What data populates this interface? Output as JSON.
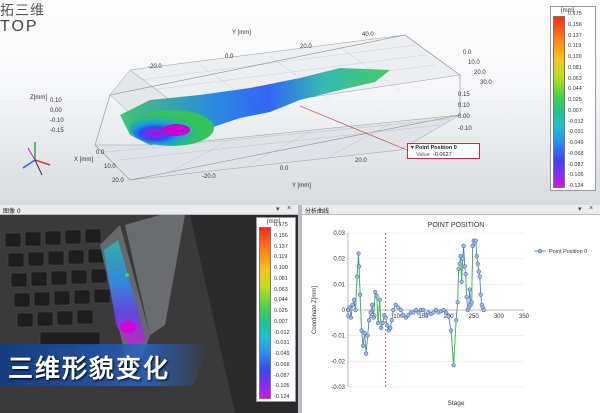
{
  "logo": {
    "cn": "拓三维",
    "en": "TOP"
  },
  "view3d": {
    "axis_y_label": "Y [mm]",
    "axis_y_ticks_top": [
      "-20.0",
      "0.0",
      "20.0",
      "40.0"
    ],
    "axis_x_ticks_right": [
      "0.0",
      "10.0",
      "20.0",
      "30.0"
    ],
    "axis_z_label": "Z[mm]",
    "axis_z_ticks": [
      "0.10",
      "0.00",
      "-0.10",
      "-0.15"
    ],
    "axis_z_ticks_right": [
      "0.15",
      "0.10",
      "0.00",
      "-0.10"
    ],
    "axis_x_label_left": "X [mm]",
    "axis_x_ticks_left": [
      "0.0",
      "10.0",
      "20.0"
    ],
    "axis_y_ticks_bottom": [
      "-20.0",
      "0.0",
      "20.0"
    ],
    "axis_y_label_bottom": "Y [mm]",
    "tooltip": {
      "title": "Point Position 0",
      "label": "Value",
      "value": "-0.0627"
    }
  },
  "legend": {
    "unit": "[mm]",
    "ticks": [
      "0.175",
      "0.156",
      "0.137",
      "0.119",
      "0.100",
      "0.081",
      "0.063",
      "0.044",
      "0.025",
      "0.007",
      "-0.012",
      "-0.031",
      "-0.049",
      "-0.068",
      "-0.087",
      "-0.105",
      "-0.124"
    ]
  },
  "left_panel": {
    "title": "图像 0",
    "pin": "▾",
    "close": "×"
  },
  "right_panel": {
    "title": "分析曲线",
    "pin": "▾",
    "close": "×"
  },
  "banner": {
    "text": "三维形貌变化"
  },
  "chart_data": {
    "type": "line",
    "title": "POINT POSITION",
    "xlabel": "Stage",
    "ylabel": "Coordinate Z[mm]",
    "xlim": [
      0,
      350
    ],
    "ylim": [
      -0.03,
      0.03
    ],
    "xticks": [
      0,
      50,
      100,
      150,
      200,
      250,
      300,
      350
    ],
    "yticks": [
      0.03,
      0.02,
      0.01,
      0,
      -0.01,
      -0.02,
      -0.03
    ],
    "ytick_labels": [
      "0.03",
      "0.02",
      "0.01",
      "0",
      "-0.01",
      "-0.02",
      "-0.03"
    ],
    "marker_x": 75,
    "legend_position": "top-right",
    "series": [
      {
        "name": "Point Position 0",
        "color": "#4a6fb8",
        "x": [
          0,
          3,
          6,
          9,
          12,
          15,
          18,
          21,
          22,
          24,
          27,
          30,
          33,
          36,
          39,
          42,
          45,
          48,
          51,
          54,
          57,
          60,
          63,
          66,
          69,
          72,
          75,
          78,
          81,
          84,
          87,
          90,
          95,
          100,
          105,
          110,
          115,
          120,
          125,
          130,
          135,
          140,
          145,
          150,
          155,
          160,
          165,
          170,
          175,
          180,
          185,
          190,
          195,
          200,
          205,
          210,
          215,
          218,
          220,
          222,
          224,
          226,
          228,
          230,
          232,
          234,
          236,
          238,
          240,
          242,
          244,
          246,
          248,
          250,
          252,
          254,
          256,
          258,
          260,
          262,
          264,
          266,
          268,
          270
        ],
        "y": [
          0.0,
          0.001,
          -0.003,
          0.002,
          0.004,
          0.0,
          0.013,
          0.022,
          0.017,
          0.006,
          -0.008,
          -0.014,
          -0.009,
          -0.017,
          -0.01,
          -0.004,
          -0.001,
          0.002,
          -0.003,
          0.007,
          0.0055,
          -0.005,
          0.004,
          -0.007,
          -0.005,
          -0.002,
          -0.003,
          -0.006,
          -0.008,
          -0.007,
          -0.004,
          0.0,
          0.002,
          0.001,
          0.0,
          -0.002,
          -0.003,
          -0.002,
          -0.001,
          -0.001,
          0.0,
          -0.001,
          0.0,
          0.0,
          -0.002,
          -0.001,
          -0.0015,
          -0.001,
          0.0,
          -0.001,
          -0.0005,
          0.0,
          -0.001,
          -0.0025,
          -0.008,
          -0.0215,
          -0.004,
          0.003,
          0.016,
          0.018,
          0.021,
          0.011,
          0.02,
          0.025,
          0.017,
          0.014,
          0.005,
          0.0,
          0.001,
          0.008,
          0.002,
          0.003,
          0.025,
          0.027,
          0.026,
          0.027,
          0.021,
          0.018,
          0.015,
          0.013,
          0.006,
          0.002,
          0.001,
          0.0
        ]
      }
    ]
  }
}
